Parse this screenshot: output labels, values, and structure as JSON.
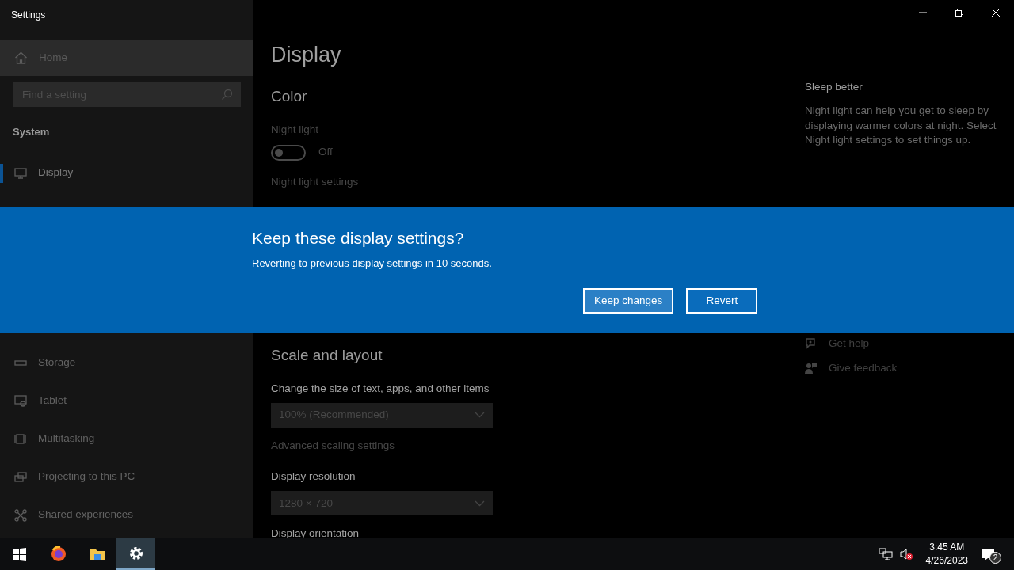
{
  "window": {
    "title": "Settings"
  },
  "sidebar": {
    "home": {
      "label": "Home"
    },
    "search": {
      "placeholder": "Find a setting"
    },
    "section": "System",
    "items_top": [
      {
        "label": "Display",
        "selected": true
      }
    ],
    "items": [
      {
        "label": "Storage",
        "selected": false
      },
      {
        "label": "Tablet",
        "selected": false
      },
      {
        "label": "Multitasking",
        "selected": false
      },
      {
        "label": "Projecting to this PC",
        "selected": false
      },
      {
        "label": "Shared experiences",
        "selected": false
      }
    ]
  },
  "content": {
    "title": "Display",
    "color": {
      "heading": "Color",
      "night_light": {
        "label": "Night light",
        "on": false,
        "state_text": "Off"
      },
      "link": "Night light settings"
    },
    "scale": {
      "heading": "Scale and layout",
      "size_label": "Change the size of text, apps, and other items",
      "size_value": "100% (Recommended)",
      "advanced_link": "Advanced scaling settings",
      "resolution_label": "Display resolution",
      "resolution_value": "1280 × 720",
      "orientation_label": "Display orientation"
    }
  },
  "aside": {
    "title": "Sleep better",
    "text": "Night light can help you get to sleep by displaying warmer colors at night. Select Night light settings to set things up.",
    "links": [
      {
        "label": "Get help"
      },
      {
        "label": "Give feedback"
      }
    ]
  },
  "dialog": {
    "title": "Keep these display settings?",
    "message": "Reverting to previous display settings in 10 seconds.",
    "buttons": [
      {
        "label": "Keep changes",
        "hovered": true
      },
      {
        "label": "Revert",
        "hovered": false
      }
    ]
  },
  "taskbar": {
    "apps": [
      {
        "active": false
      },
      {
        "active": false
      },
      {
        "active": true
      }
    ],
    "time": "3:45 AM",
    "date": "4/26/2023",
    "notifications": "2"
  }
}
